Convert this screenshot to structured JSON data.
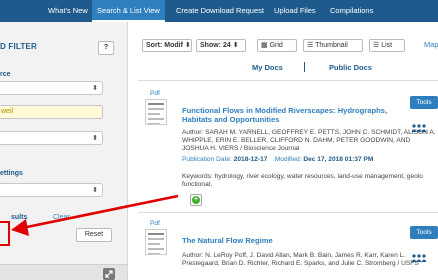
{
  "topnav": {
    "tabs": [
      {
        "label": "What's New"
      },
      {
        "label": "Search & List View",
        "active": true
      },
      {
        "label": "Create Download Request"
      },
      {
        "label": "Upload Files"
      },
      {
        "label": "Compilations"
      }
    ]
  },
  "sidebar": {
    "title": "D FILTER",
    "help_label": "?",
    "resource_label": "rce",
    "resource_arrow": "⬍",
    "search_value": "weil",
    "select_two_arrow": "⬍",
    "settings_label": "ettings",
    "select_three_arrow": "⬍",
    "results_label": "sults",
    "clear_label": "Clear",
    "reset_label": "Reset"
  },
  "toolbar": {
    "sort_label": "Sort: Modif",
    "sort_arrow": "⬍",
    "show_label": "Show: 24",
    "show_arrow": "⬍",
    "grid_label": "Grid",
    "thumbnail_label": "Thumbnail",
    "list_label": "List",
    "map_label": "Map",
    "my_docs": "My Docs",
    "public_docs": "Public Docs"
  },
  "results": [
    {
      "type_label": "Pdf",
      "title": "Functional Flows in Modified Riverscapes: Hydrographs, Habitats and Opportunities",
      "authors": "Author: SARAH M. YARNELL, GEOFFREY E. PETTS, JOHN C. SCHMIDT, ALISON A. WHIPPLE, ERIN E. BELLER, CLIFFORD N. DAHM, PETER GOODWIN, AND JOSHUA H. VIERS / Bioscience Journal",
      "pub_label": "Publication Date:",
      "pub_date": "2018-12-17",
      "mod_label": "Modified:",
      "mod_date": "Dec 17, 2018 01:37 PM",
      "keywords": "Keywords: hydrology, river ecology, water resources, land-use management, geolo functional,",
      "tools_label": "Tools",
      "add_glyph": "+"
    },
    {
      "type_label": "Pdf",
      "title": "The Natural Flow Regime",
      "authors": "Author: N. LeRoy Poff, J. David Allan, Mark B. Bain, James R. Karr, Karen L. Prestegaard, Brian D. Richter, Richard E. Sparks, and Julie C. Stromberg / USFS",
      "tools_label": "Tools"
    }
  ],
  "colors": {
    "nav": "#1e5b8c",
    "nav_active": "#2f7fbf",
    "accent": "#2f7fbf",
    "highlight_input": "#fffbd6",
    "annotation": "#e00000",
    "add_green": "#3fae2a"
  },
  "icons": {
    "help": "help-icon",
    "dropdown": "updown-arrow-icon",
    "grid": "grid-icon",
    "thumbnail": "thumbnail-icon",
    "list": "list-icon",
    "people": "people-icon",
    "add": "add-icon",
    "expand": "expand-icon",
    "arrow": "red-arrow-annotation"
  }
}
